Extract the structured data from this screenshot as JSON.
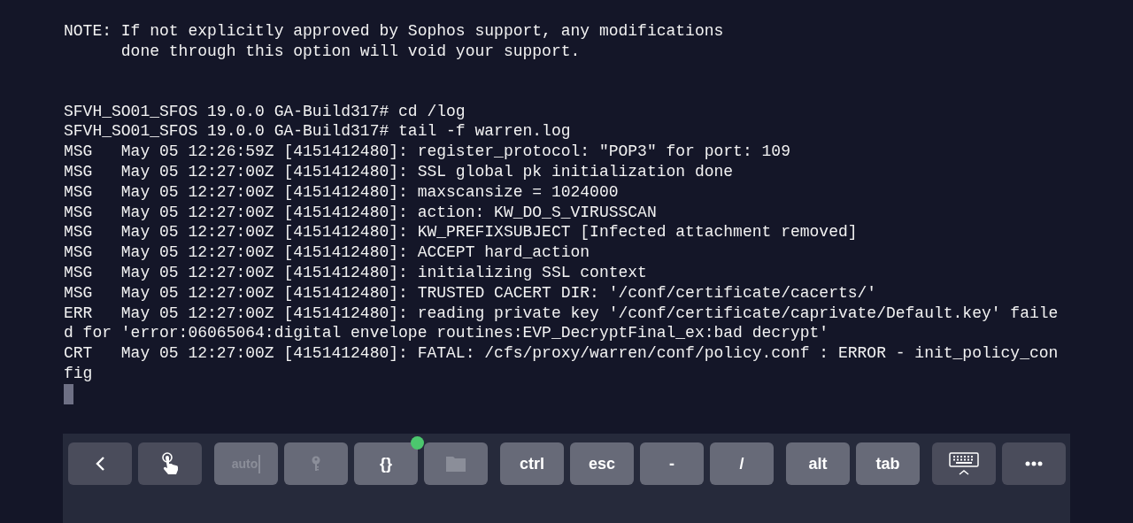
{
  "terminal": {
    "notice": [
      "NOTE: If not explicitly approved by Sophos support, any modifications",
      "      done through this option will void your support."
    ],
    "session": [
      "SFVH_SO01_SFOS 19.0.0 GA-Build317# cd /log",
      "SFVH_SO01_SFOS 19.0.0 GA-Build317# tail -f warren.log",
      "MSG   May 05 12:26:59Z [4151412480]: register_protocol: \"POP3\" for port: 109",
      "MSG   May 05 12:27:00Z [4151412480]: SSL global pk initialization done",
      "MSG   May 05 12:27:00Z [4151412480]: maxscansize = 1024000",
      "MSG   May 05 12:27:00Z [4151412480]: action: KW_DO_S_VIRUSSCAN",
      "MSG   May 05 12:27:00Z [4151412480]: KW_PREFIXSUBJECT [Infected attachment removed]",
      "MSG   May 05 12:27:00Z [4151412480]: ACCEPT hard_action",
      "MSG   May 05 12:27:00Z [4151412480]: initializing SSL context",
      "MSG   May 05 12:27:00Z [4151412480]: TRUSTED CACERT DIR: '/conf/certificate/cacerts/'",
      "ERR   May 05 12:27:00Z [4151412480]: reading private key '/conf/certificate/caprivate/Default.key' faile",
      "d for 'error:06065064:digital envelope routines:EVP_DecryptFinal_ex:bad decrypt'",
      "CRT   May 05 12:27:00Z [4151412480]: FATAL: /cfs/proxy/warren/conf/policy.conf : ERROR - init_policy_con",
      "fig"
    ]
  },
  "toolbar": {
    "groups": [
      [
        {
          "kind": "back",
          "disabled": false
        },
        {
          "kind": "touch",
          "disabled": false
        }
      ],
      [
        {
          "kind": "text",
          "label": "auto",
          "disabled": true
        },
        {
          "kind": "key",
          "disabled": true
        },
        {
          "kind": "text",
          "label": "{}",
          "disabled": false,
          "color": "#4cc76e"
        },
        {
          "kind": "folder",
          "disabled": true
        }
      ],
      [
        {
          "kind": "text",
          "label": "ctrl",
          "disabled": false
        },
        {
          "kind": "text",
          "label": "esc",
          "disabled": false
        },
        {
          "kind": "text",
          "label": "-",
          "disabled": false
        },
        {
          "kind": "text",
          "label": "/",
          "disabled": false
        }
      ],
      [
        {
          "kind": "text",
          "label": "alt",
          "disabled": false
        },
        {
          "kind": "text",
          "label": "tab",
          "disabled": false
        }
      ],
      [
        {
          "kind": "keyboard",
          "disabled": false
        },
        {
          "kind": "more",
          "disabled": false
        }
      ]
    ]
  }
}
